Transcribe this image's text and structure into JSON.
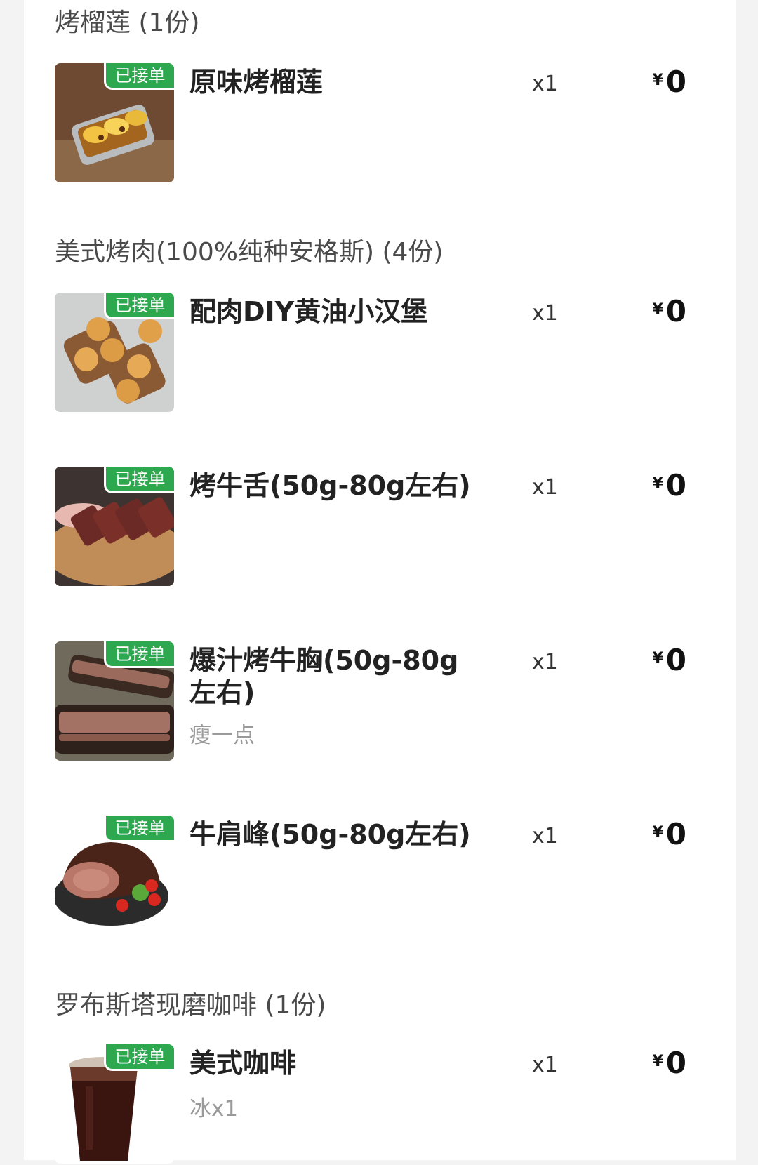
{
  "badge_color": "#2ea84f",
  "groups": [
    {
      "title": "烤榴莲 (1份)",
      "items": [
        {
          "name": "原味烤榴莲",
          "spec": "",
          "badge": "已接单",
          "qty": "x1",
          "currency": "¥",
          "price": "0",
          "image_icon": "durian-tray-image"
        }
      ]
    },
    {
      "title": "美式烤肉(100%纯种安格斯) (4份)",
      "items": [
        {
          "name": "配肉DIY黄油小汉堡",
          "spec": "",
          "badge": "已接单",
          "qty": "x1",
          "currency": "¥",
          "price": "0",
          "image_icon": "burger-buns-image"
        },
        {
          "name": "烤牛舌(50g-80g左右)",
          "spec": "",
          "badge": "已接单",
          "qty": "x1",
          "currency": "¥",
          "price": "0",
          "image_icon": "beef-tongue-image"
        },
        {
          "name": "爆汁烤牛胸(50g-80g左右)",
          "spec": "瘦一点",
          "badge": "已接单",
          "qty": "x1",
          "currency": "¥",
          "price": "0",
          "image_icon": "brisket-image"
        },
        {
          "name": "牛肩峰(50g-80g左右)",
          "spec": "",
          "badge": "已接单",
          "qty": "x1",
          "currency": "¥",
          "price": "0",
          "image_icon": "beef-hump-image"
        }
      ]
    },
    {
      "title": "罗布斯塔现磨咖啡 (1份)",
      "items": [
        {
          "name": "美式咖啡",
          "spec": "冰x1",
          "badge": "已接单",
          "qty": "x1",
          "currency": "¥",
          "price": "0",
          "image_icon": "iced-coffee-image"
        }
      ]
    }
  ]
}
